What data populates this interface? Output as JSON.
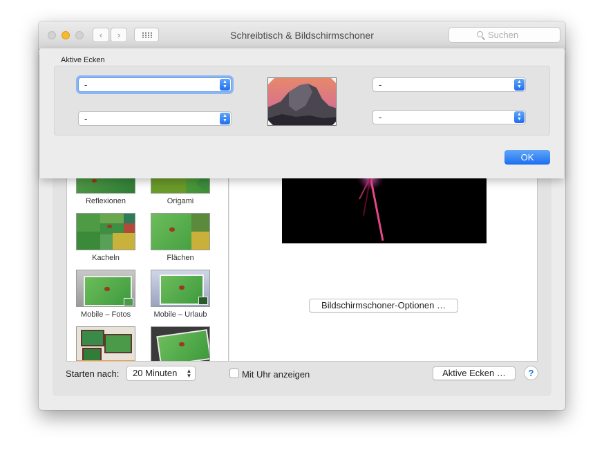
{
  "window": {
    "title": "Schreibtisch & Bildschirmschoner",
    "search_placeholder": "Suchen",
    "nav_back": "‹",
    "nav_forward": "›"
  },
  "screensavers": [
    {
      "label": "Reflexionen"
    },
    {
      "label": "Origami"
    },
    {
      "label": "Kacheln"
    },
    {
      "label": "Flächen"
    },
    {
      "label": "Mobile – Fotos"
    },
    {
      "label": "Mobile – Urlaub"
    }
  ],
  "preview": {
    "options_button": "Bildschirmschoner-Optionen …"
  },
  "bottom_bar": {
    "start_label": "Starten nach:",
    "start_value": "20 Minuten",
    "clock_label": "Mit Uhr anzeigen",
    "hot_corners_button": "Aktive Ecken …",
    "help": "?"
  },
  "sheet": {
    "group_label": "Aktive Ecken",
    "top_left": "-",
    "bottom_left": "-",
    "top_right": "-",
    "bottom_right": "-",
    "ok_label": "OK"
  },
  "colors": {
    "accent": "#1f6ff0",
    "focus_ring": "#8ab6f5",
    "traffic_minimize": "#f5b932"
  }
}
